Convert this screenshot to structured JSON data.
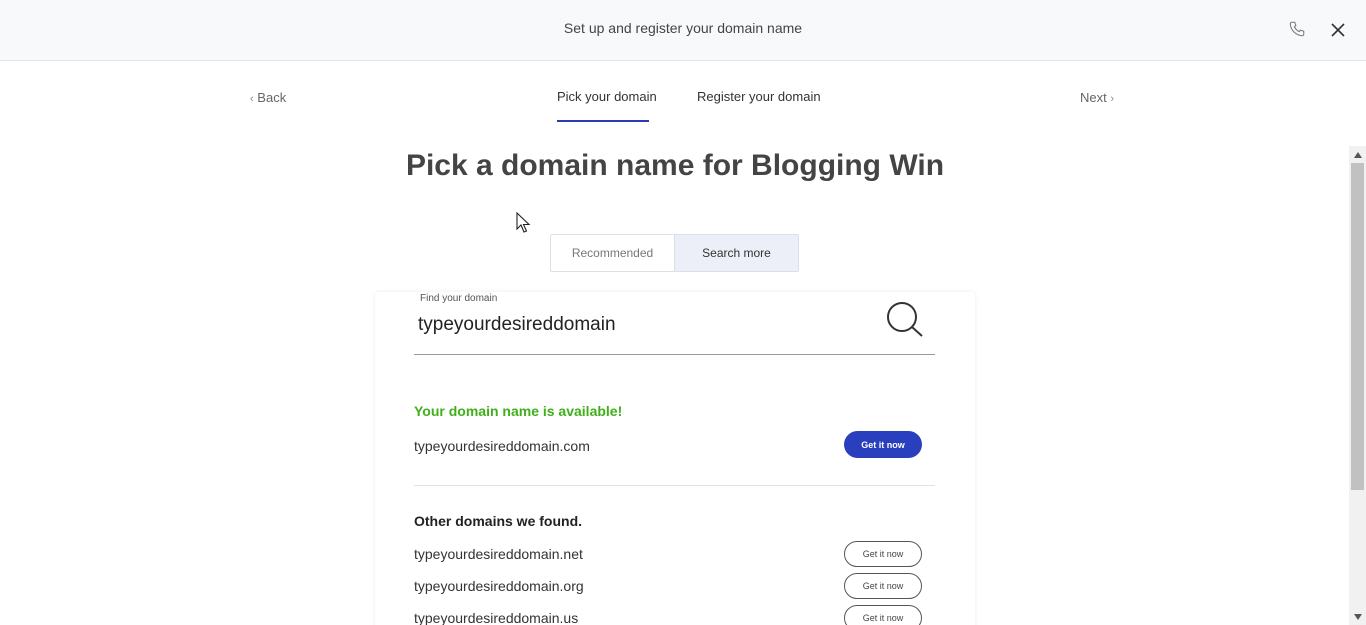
{
  "header": {
    "title": "Set up and register your domain name"
  },
  "nav": {
    "back_label": "Back",
    "next_label": "Next",
    "tabs": [
      {
        "label": "Pick your domain",
        "active": true
      },
      {
        "label": "Register your domain",
        "active": false
      }
    ]
  },
  "main": {
    "heading": "Pick a domain name for Blogging Win",
    "segments": [
      {
        "label": "Recommended",
        "selected": false
      },
      {
        "label": "Search more",
        "selected": true
      }
    ],
    "search": {
      "label": "Find your domain",
      "value": "typeyourdesireddomain"
    },
    "result": {
      "status": "Your domain name is available!",
      "status_color": "#3fb01a",
      "domain": "typeyourdesireddomain.com",
      "button_label": "Get it now"
    },
    "others": {
      "title": "Other domains we found.",
      "items": [
        {
          "domain": "typeyourdesireddomain.net",
          "button_label": "Get it now"
        },
        {
          "domain": "typeyourdesireddomain.org",
          "button_label": "Get it now"
        },
        {
          "domain": "typeyourdesireddomain.us",
          "button_label": "Get it now"
        }
      ]
    }
  },
  "colors": {
    "accent": "#2a3fbe",
    "available": "#3fb01a"
  },
  "icons": [
    "phone-icon",
    "close-icon",
    "search-icon",
    "chevron-left-icon",
    "chevron-right-icon",
    "cursor-icon"
  ]
}
